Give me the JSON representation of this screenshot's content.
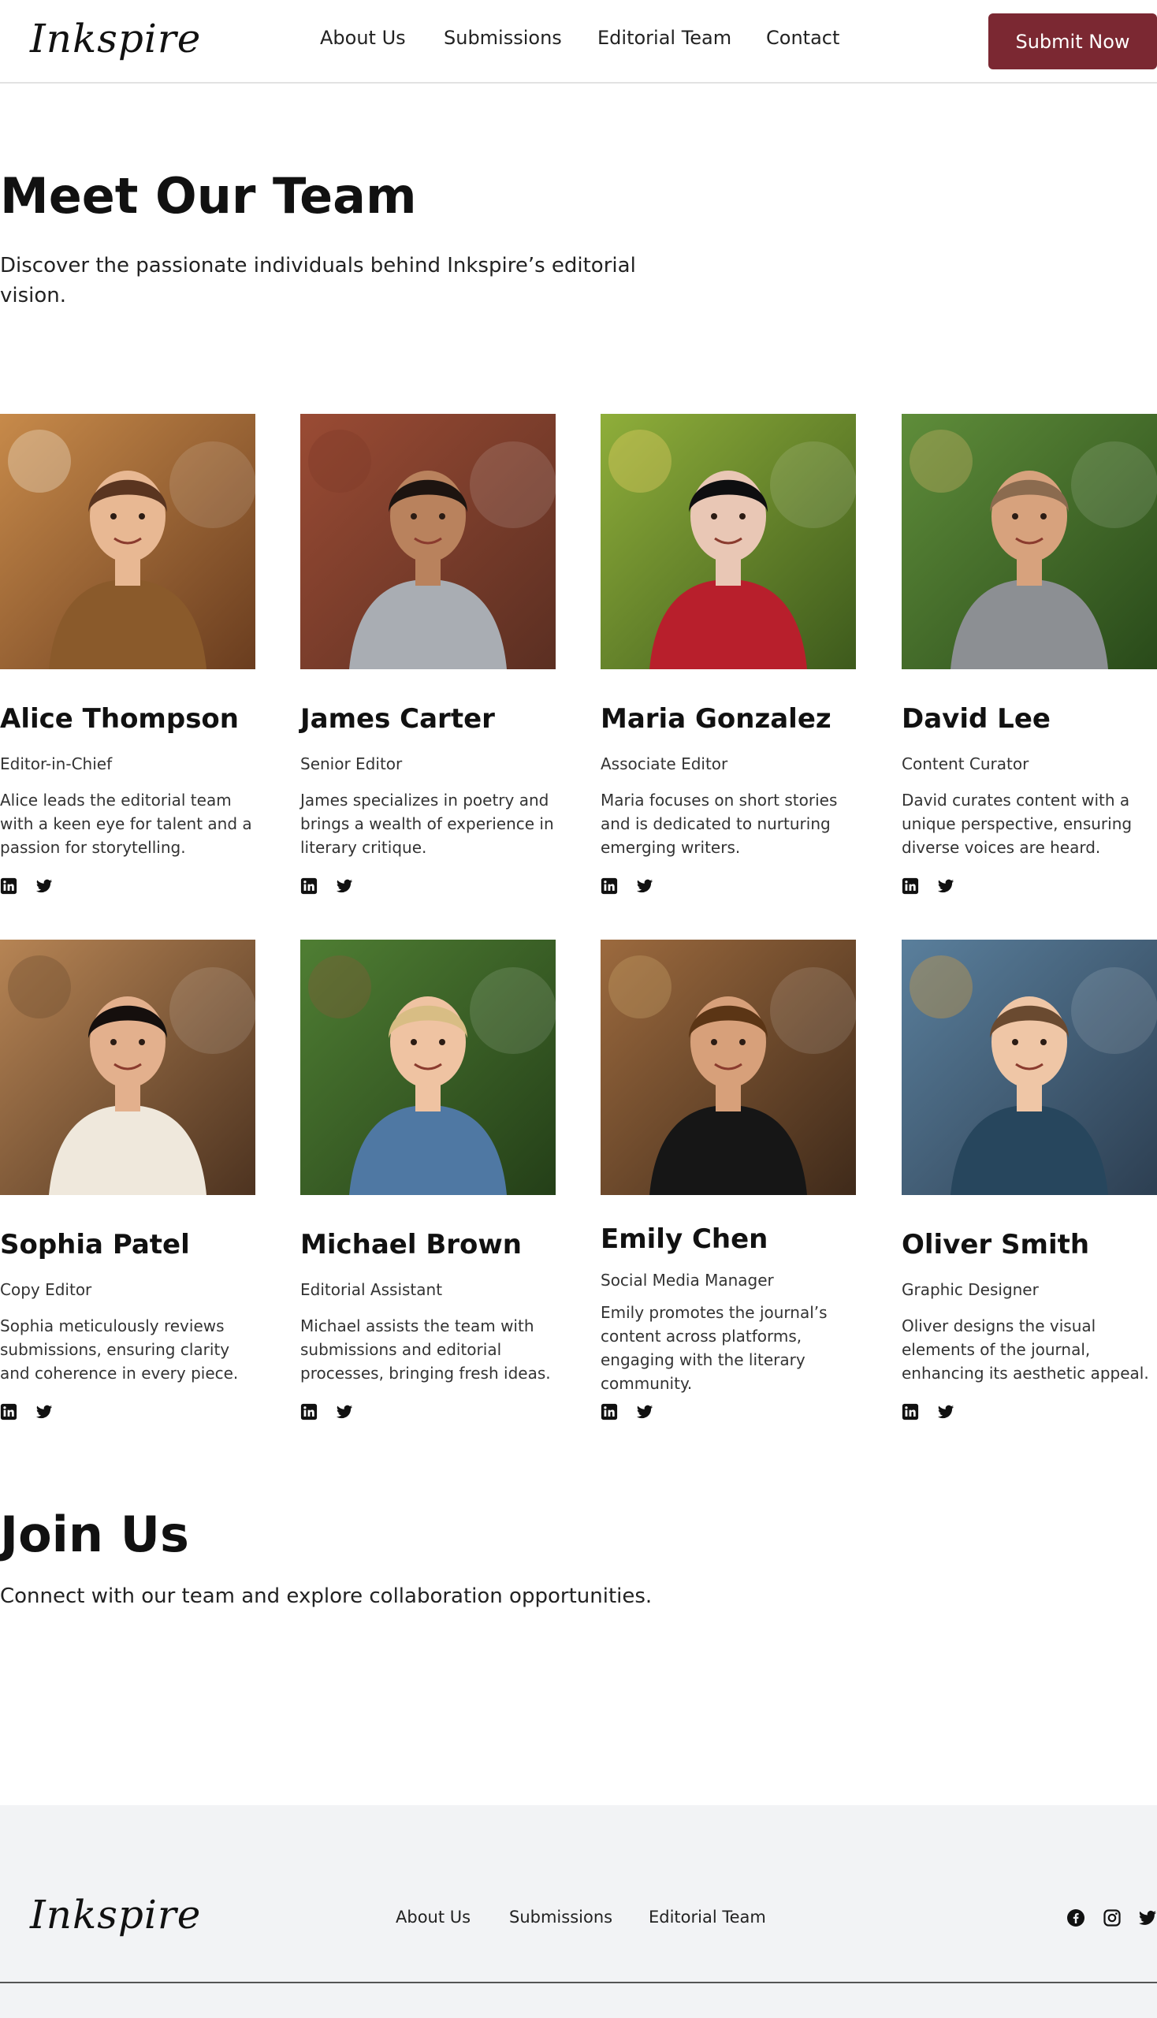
{
  "header": {
    "logo": "Inkspire",
    "nav": [
      "About Us",
      "Submissions",
      "Editorial Team",
      "Contact"
    ],
    "cta": "Submit Now"
  },
  "hero": {
    "title": "Meet Our Team",
    "subtitle": "Discover the passionate individuals behind Inkspire’s editorial vision."
  },
  "team": [
    {
      "name": "Alice Thompson",
      "role": "Editor-in-Chief",
      "bio": "Alice leads the editorial team with a keen eye for talent and a passion for storytelling.",
      "photo": "photo-woman-reading-cafe",
      "socials": [
        "linkedin-icon",
        "twitter-icon"
      ]
    },
    {
      "name": "James Carter",
      "role": "Senior Editor",
      "bio": "James specializes in poetry and brings a wealth of experience in literary critique.",
      "photo": "photo-man-brick-wall",
      "socials": [
        "linkedin-icon",
        "twitter-icon"
      ]
    },
    {
      "name": "Maria Gonzalez",
      "role": "Associate Editor",
      "bio": "Maria focuses on short stories and is dedicated to nurturing emerging writers.",
      "photo": "photo-woman-park-bench",
      "socials": [
        "linkedin-icon",
        "twitter-icon"
      ]
    },
    {
      "name": "David Lee",
      "role": "Content Curator",
      "bio": "David curates content with a unique perspective, ensuring diverse voices are heard.",
      "photo": "photo-man-park-books",
      "socials": [
        "linkedin-icon",
        "twitter-icon"
      ]
    },
    {
      "name": "Sophia Patel",
      "role": "Copy Editor",
      "bio": "Sophia meticulously reviews submissions, ensuring clarity and coherence in every piece.",
      "photo": "photo-woman-vintage-room",
      "socials": [
        "linkedin-icon",
        "twitter-icon"
      ]
    },
    {
      "name": "Michael Brown",
      "role": "Editorial Assistant",
      "bio": "Michael assists the team with submissions and editorial processes, bringing fresh ideas.",
      "photo": "photo-man-bench-book",
      "socials": [
        "linkedin-icon",
        "twitter-icon"
      ]
    },
    {
      "name": "Emily Chen",
      "role": "Social Media Manager",
      "bio": "Emily promotes the journal’s content across platforms, engaging with the literary community.",
      "photo": "photo-woman-bookstore",
      "socials": [
        "linkedin-icon",
        "twitter-icon"
      ]
    },
    {
      "name": "Oliver Smith",
      "role": "Graphic Designer",
      "bio": "Oliver designs the visual elements of the journal, enhancing its aesthetic appeal.",
      "photo": "photo-man-art-studio",
      "socials": [
        "linkedin-icon",
        "twitter-icon"
      ]
    }
  ],
  "join": {
    "title": "Join Us",
    "subtitle": "Connect with our team and explore collaboration opportunities."
  },
  "footer": {
    "logo": "Inkspire",
    "nav": [
      "About Us",
      "Submissions",
      "Editorial Team"
    ],
    "socials": [
      "facebook-icon",
      "instagram-icon",
      "twitter-icon"
    ]
  },
  "colors": {
    "accent": "#7b2832",
    "footer_bg": "#f2f3f5",
    "text": "#111111"
  }
}
